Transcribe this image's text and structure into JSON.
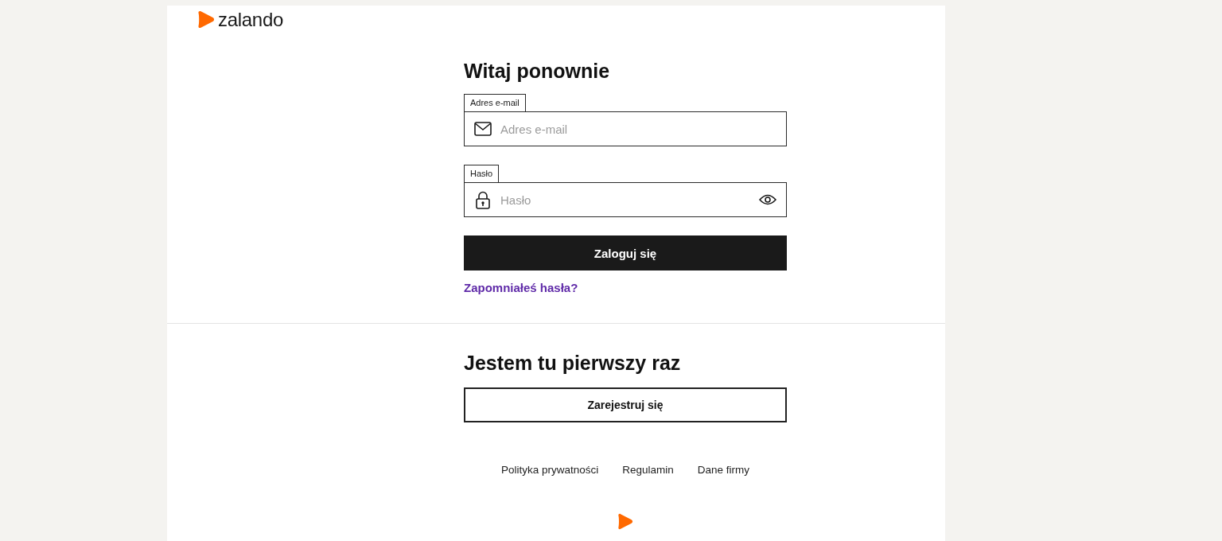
{
  "header": {
    "logo_text": "zalando"
  },
  "login": {
    "title": "Witaj ponownie",
    "fields": [
      {
        "kind": "email",
        "label": "Adres e-mail",
        "placeholder": "Adres e-mail"
      },
      {
        "kind": "password",
        "label": "Hasło",
        "placeholder": "Hasło"
      }
    ],
    "submit": "Zaloguj się",
    "forgot_link": "Zapomniałeś hasła?"
  },
  "register": {
    "title": "Jestem tu pierwszy raz",
    "button": "Zarejestruj się"
  },
  "footer": {
    "links": [
      "Polityka prywatności",
      "Regulamin",
      "Dane firmy"
    ]
  }
}
